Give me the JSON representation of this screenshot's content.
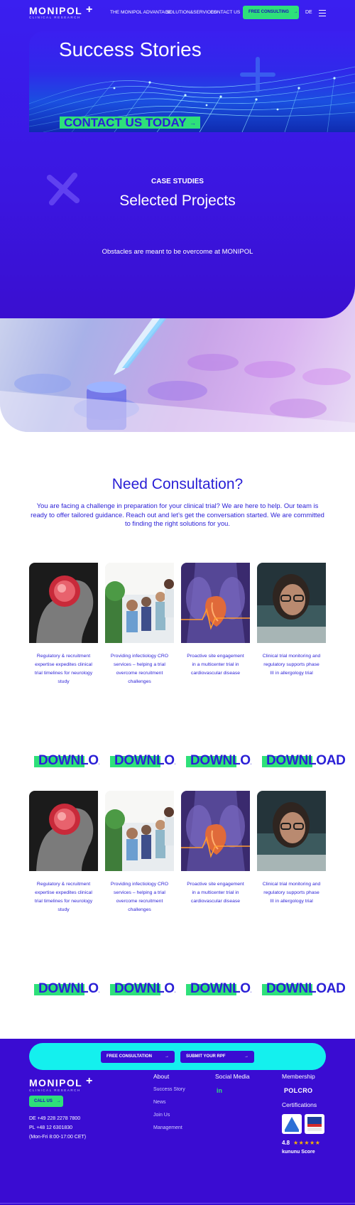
{
  "nav": {
    "logo": "MONIPOL",
    "logo_sub": "CLINICAL RESEARCH",
    "links": [
      "THE MONIPOL ADVANTAGE",
      "SOLUTION&SERVICES",
      "CONTACT US"
    ],
    "cta": "FREE CONSULTING",
    "lang": "DE"
  },
  "hero": {
    "title": "Success Stories",
    "contact_button": "CONTACT US TODAY",
    "kicker": "CASE STUDIES",
    "section_title": "Selected Projects",
    "tagline": "Obstacles are meant to be overcome at MONIPOL"
  },
  "consultation": {
    "title": "Need Consultation?",
    "text": "You are facing a challenge in preparation for your clinical trial? We are here to help. Our team is ready to offer tailored guidance. Reach out and let’s get the conversation started. We are committed to finding the right solutions for you."
  },
  "cases": [
    {
      "caption": "Regulatory & recruitment expertise expedites clinical trial timelines for neurology study",
      "image": "brain-scan"
    },
    {
      "caption": "Providing infectiology CRO services – helping a trial overcome recruitment challenges",
      "image": "waiting-room"
    },
    {
      "caption": "Proactive site engagement in a multicenter trial in cardiovascular disease",
      "image": "heart-xray"
    },
    {
      "caption": "Clinical trial monitoring and regulatory supports phase III in allergology trial",
      "image": "researcher"
    }
  ],
  "download_label": "DOWNLOAD",
  "footer": {
    "cta_consultation": "FREE CONSULTATION",
    "cta_rfp": "SUBMIT YOUR RPF",
    "logo": "MONIPOL",
    "logo_sub": "CLINICAL RESEARCH",
    "call_us": "CALL US",
    "phone_de": "DE +49 228 2278 7800",
    "phone_pl": "PL +48 12 6301830",
    "hours": "(Mon-Fri 8:00-17:00 CET)",
    "about_heading": "About",
    "about_links": [
      "Success Story",
      "News",
      "Join Us",
      "Management"
    ],
    "social_heading": "Social Media",
    "social_icon": "linkedin-icon",
    "linkedin_glyph": "in",
    "membership_heading": "Membership",
    "membership_logo": "POLCRO",
    "certifications_heading": "Certifications",
    "rating": "4.8",
    "stars": "★★★★★",
    "kununu": "kununu Score"
  },
  "colors": {
    "brand_blue": "#3a1ff0",
    "accent_green": "#2ee07a",
    "cyan": "#14f0ee",
    "footer": "#3a0cd2"
  }
}
